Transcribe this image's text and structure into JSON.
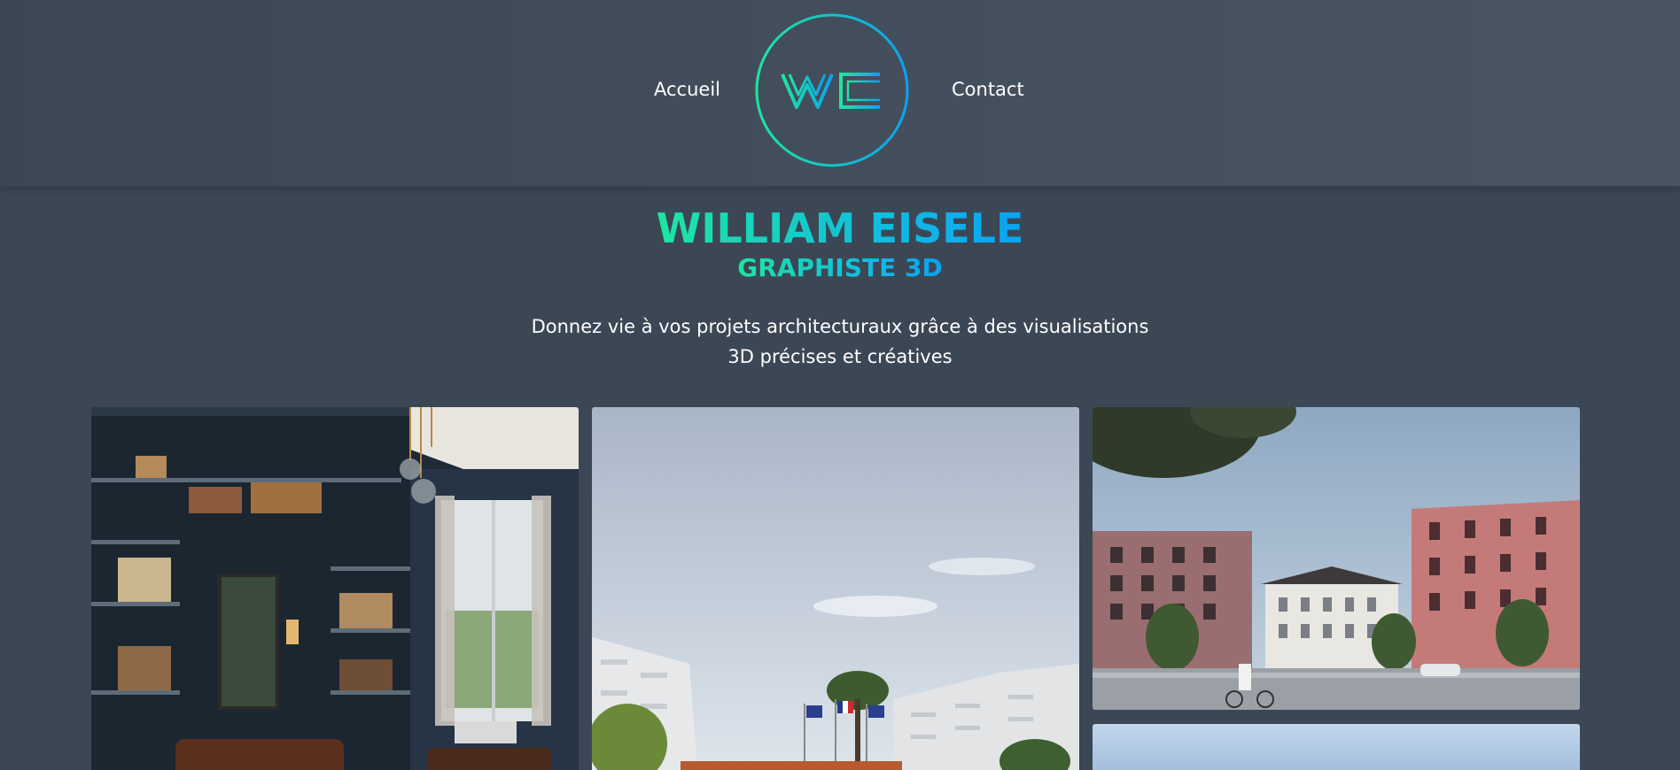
{
  "nav": {
    "home_label": "Accueil",
    "contact_label": "Contact",
    "logo_text": "WE"
  },
  "hero": {
    "name": "WILLIAM EISELE",
    "role": "GRAPHISTE 3D",
    "tagline_line1": "Donnez vie à vos projets architecturaux grâce à des visualisations",
    "tagline_line2": "3D précises et créatives"
  },
  "colors": {
    "background": "#3c4756",
    "accent_start": "#1de6a0",
    "accent_end": "#0aa3f0",
    "text": "#ffffff"
  },
  "gallery": {
    "items": [
      {
        "subject": "interior-library-render"
      },
      {
        "subject": "modern-building-with-flags-render"
      },
      {
        "subject": "red-residential-buildings-render"
      },
      {
        "subject": "sky-render-partial"
      }
    ]
  }
}
